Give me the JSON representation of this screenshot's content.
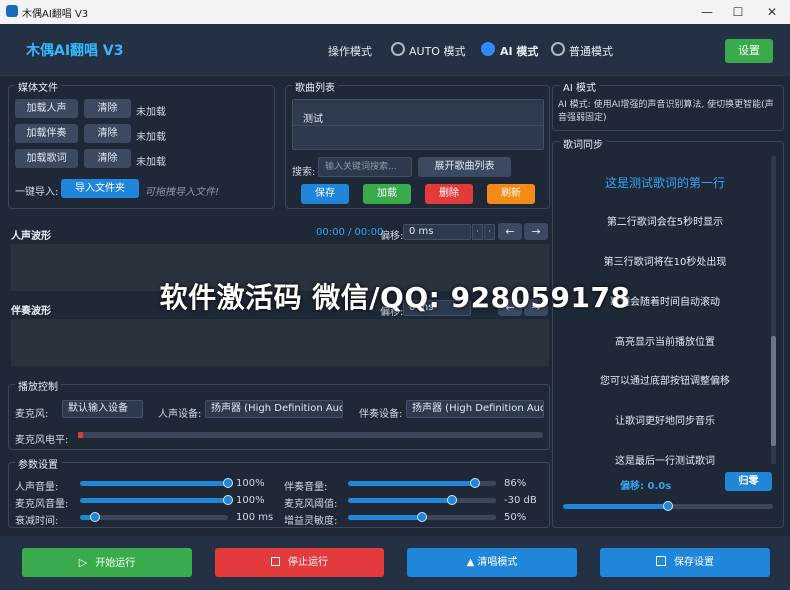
{
  "window": {
    "title": "木偶AI翻唱 V3",
    "minimize": "—",
    "maximize": "☐",
    "close": "✕"
  },
  "header": {
    "app_name": "木偶AI翻唱 V3",
    "mode_label": "操作模式",
    "modes": [
      {
        "label": "AUTO 模式",
        "selected": false
      },
      {
        "label": "AI 模式",
        "selected": true
      },
      {
        "label": "普通模式",
        "selected": false
      }
    ],
    "settings_label": "设置"
  },
  "media": {
    "title": "媒体文件",
    "rows": [
      {
        "load": "加载人声",
        "clear": "清除",
        "status": "未加载"
      },
      {
        "load": "加载伴奏",
        "clear": "清除",
        "status": "未加载"
      },
      {
        "load": "加载歌词",
        "clear": "清除",
        "status": "未加载"
      }
    ],
    "one_click_label": "一键导入:",
    "import_folder": "导入文件夹",
    "drag_hint": "可拖拽导入文件!"
  },
  "songs": {
    "title": "歌曲列表",
    "items": [
      "测试"
    ],
    "search_label": "搜索:",
    "search_placeholder": "输入关键词搜索...",
    "expand": "展开歌曲列表",
    "save": "保存",
    "load": "加载",
    "delete": "删除",
    "refresh": "刷新"
  },
  "waves": {
    "vocal_title": "人声波形",
    "accomp_title": "伴奏波形",
    "time": "00:00 / 00:00",
    "offset_label": "偏移:",
    "offset_value": "0 ms",
    "left_arrow": "←",
    "right_arrow": "→"
  },
  "ai": {
    "title": "AI 模式",
    "desc": "AI 模式: 使用AI增强的声音识别算法, 使切换更智能(声音强弱固定)"
  },
  "lyrics": {
    "title": "歌词同步",
    "lines": [
      "这是测试歌词的第一行",
      "第二行歌词会在5秒时显示",
      "第三行歌词将在10秒处出现",
      "歌词会随着时间自动滚动",
      "高亮显示当前播放位置",
      "您可以通过底部按钮调整偏移",
      "让歌词更好地同步音乐",
      "这是最后一行测试歌词"
    ],
    "offset_text": "偏移: 0.0s",
    "reset": "归零",
    "slider_fraction": 0.5
  },
  "playback": {
    "title": "播放控制",
    "mic_label": "麦克风:",
    "mic_value": "默认输入设备",
    "vocal_dev_label": "人声设备:",
    "vocal_dev_value": "扬声器 (High Definition Audio)",
    "accomp_dev_label": "伴奏设备:",
    "accomp_dev_value": "扬声器 (High Definition Audio)",
    "mic_level_label": "麦克风电平:",
    "mic_level": 0.01
  },
  "params": {
    "title": "参数设置",
    "left": [
      {
        "label": "人声音量:",
        "value": "100%",
        "fraction": 1.0
      },
      {
        "label": "麦克风音量:",
        "value": "100%",
        "fraction": 1.0
      },
      {
        "label": "衰减时间:",
        "value": "100 ms",
        "fraction": 0.1
      }
    ],
    "right": [
      {
        "label": "伴奏音量:",
        "value": "86%",
        "fraction": 0.86
      },
      {
        "label": "麦克风阈值:",
        "value": "-30 dB",
        "fraction": 0.7
      },
      {
        "label": "增益灵敏度:",
        "value": "50%",
        "fraction": 0.5
      }
    ]
  },
  "footer": {
    "start": "开始运行",
    "stop": "停止运行",
    "clear_mode": "▲ 清唱模式",
    "save_settings": "保存设置"
  },
  "watermark": "软件激活码 微信/QQ: 928059178"
}
